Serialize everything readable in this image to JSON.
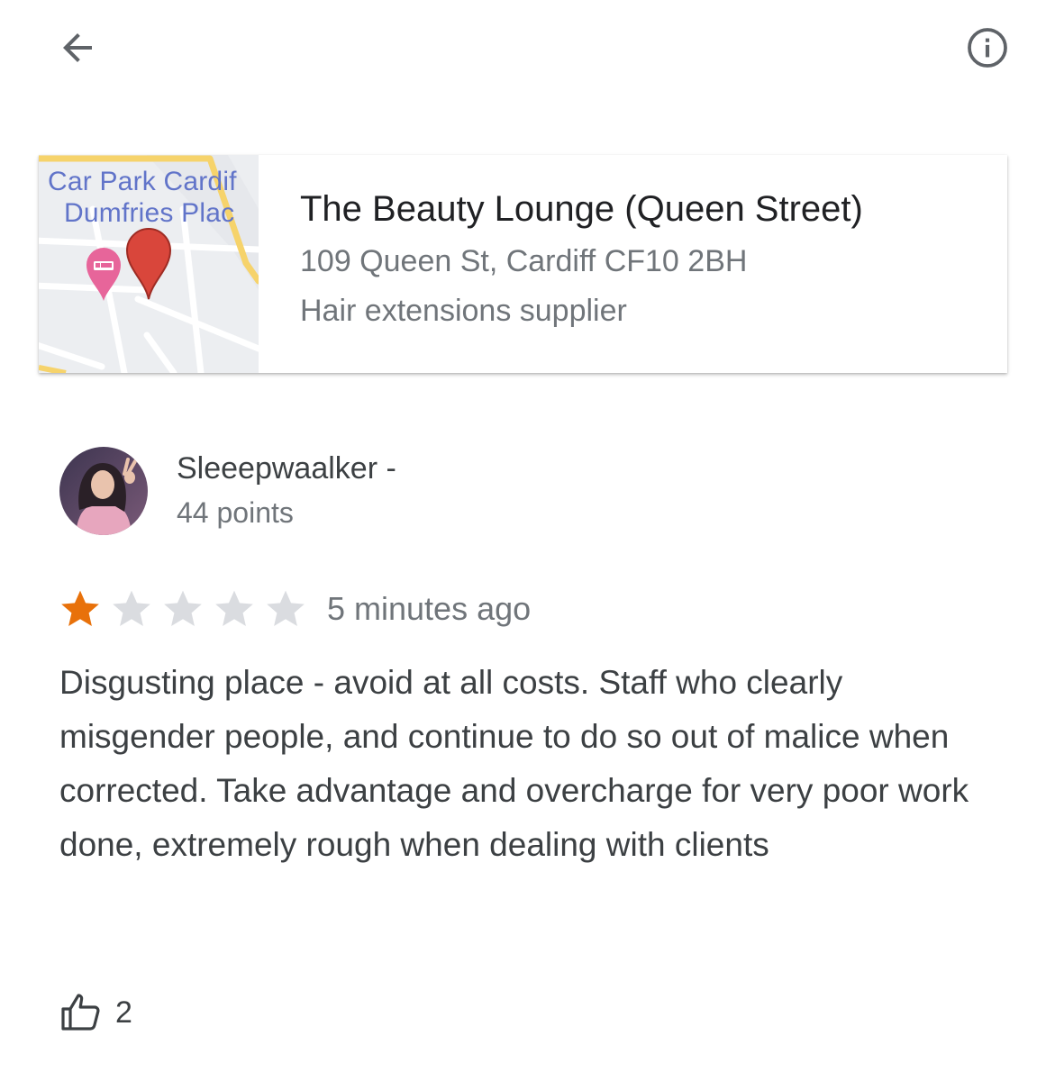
{
  "topbar": {
    "back_icon": "arrow-back-icon",
    "info_icon": "info-outline-icon"
  },
  "place": {
    "name": "The Beauty Lounge (Queen Street)",
    "address": "109 Queen St, Cardiff CF10 2BH",
    "category": "Hair extensions supplier",
    "map": {
      "label_line1": "Car Park Cardif",
      "label_line2": "Dumfries Plac",
      "pin_color": "#d9463b",
      "hotel_pin_color": "#e7659a",
      "label_color": "#6174c9"
    }
  },
  "review": {
    "reviewer_name": "Sleeepwaalker -",
    "reviewer_points": "44 points",
    "rating": 1,
    "max_rating": 5,
    "star_filled_color": "#e8710a",
    "star_empty_color": "#dadce0",
    "time": "5 minutes ago",
    "text": "Disgusting place - avoid at all costs. Staff who clearly misgender people, and continue to do so out of malice when corrected. Take advantage and overcharge for very poor work done, extremely rough when dealing with clients",
    "like_icon": "thumb-up-icon",
    "likes": "2"
  }
}
